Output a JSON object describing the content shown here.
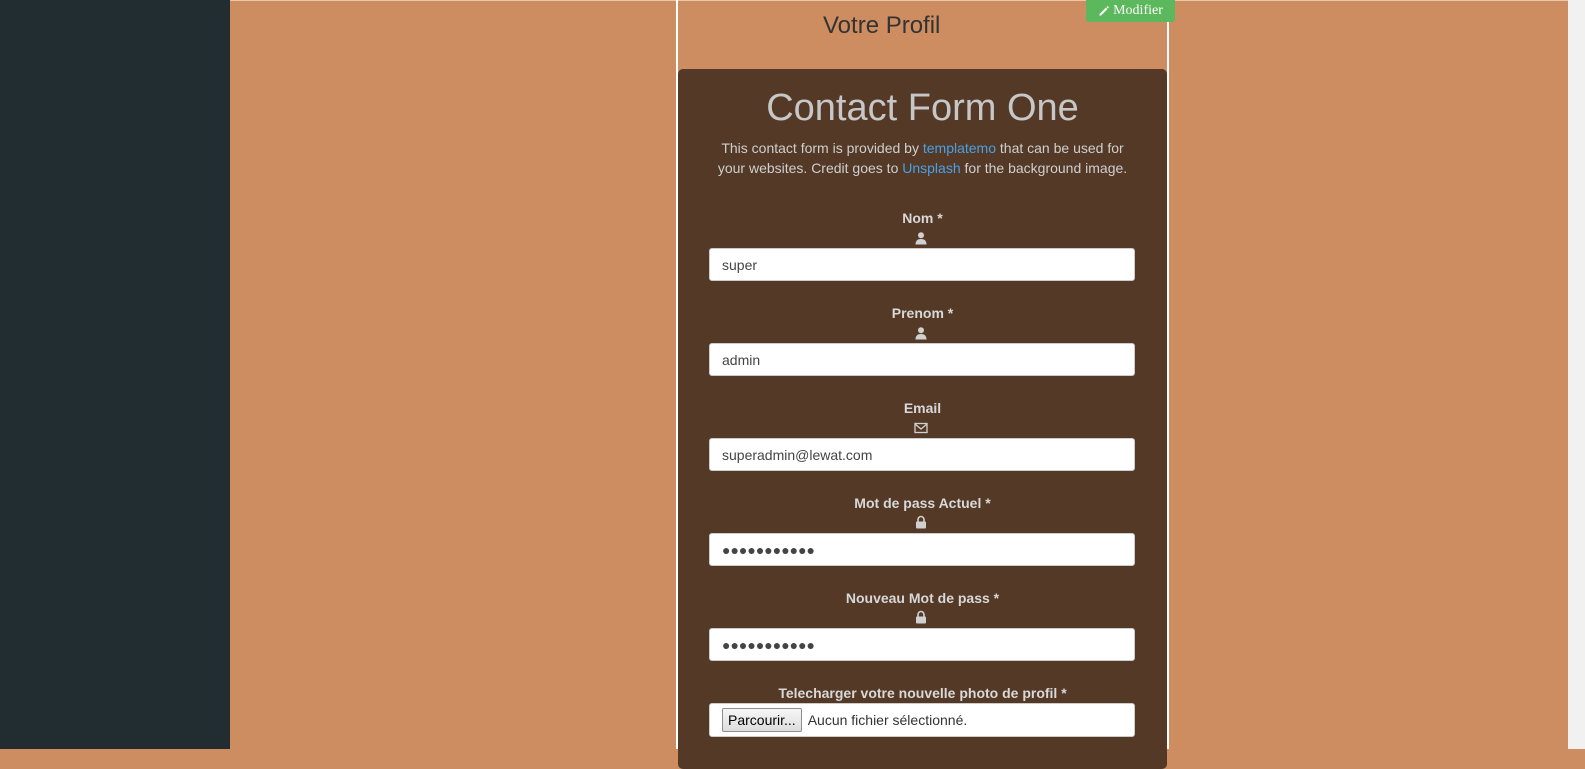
{
  "profile": {
    "title": "Votre Profil",
    "edit_label": "Modifier"
  },
  "form": {
    "heading": "Contact Form One",
    "desc_part1": "This contact form is provided by ",
    "desc_link1": "templatemo",
    "desc_part2": " that can be used for your websites. Credit goes to ",
    "desc_link2": "Unsplash",
    "desc_part3": " for the background image.",
    "fields": {
      "nom": {
        "label": "Nom *",
        "value": "super",
        "icon": "user-icon"
      },
      "prenom": {
        "label": "Prenom *",
        "value": "admin",
        "icon": "user-icon"
      },
      "email": {
        "label": "Email",
        "value": "superadmin@lewat.com",
        "icon": "envelope-icon"
      },
      "current_password": {
        "label": "Mot de pass Actuel *",
        "value": "●●●●●●●●●●●",
        "icon": "lock-icon"
      },
      "new_password": {
        "label": "Nouveau Mot de pass *",
        "value": "●●●●●●●●●●●",
        "icon": "lock-icon"
      },
      "photo": {
        "label": "Telecharger votre nouvelle photo de profil *",
        "browse_label": "Parcourir...",
        "status": "Aucun fichier sélectionné."
      }
    }
  },
  "colors": {
    "background": "#cd8d61",
    "sidebar": "#222d32",
    "card": "#533926",
    "edit_button": "#5cb85c",
    "link": "#4aa0e6"
  }
}
